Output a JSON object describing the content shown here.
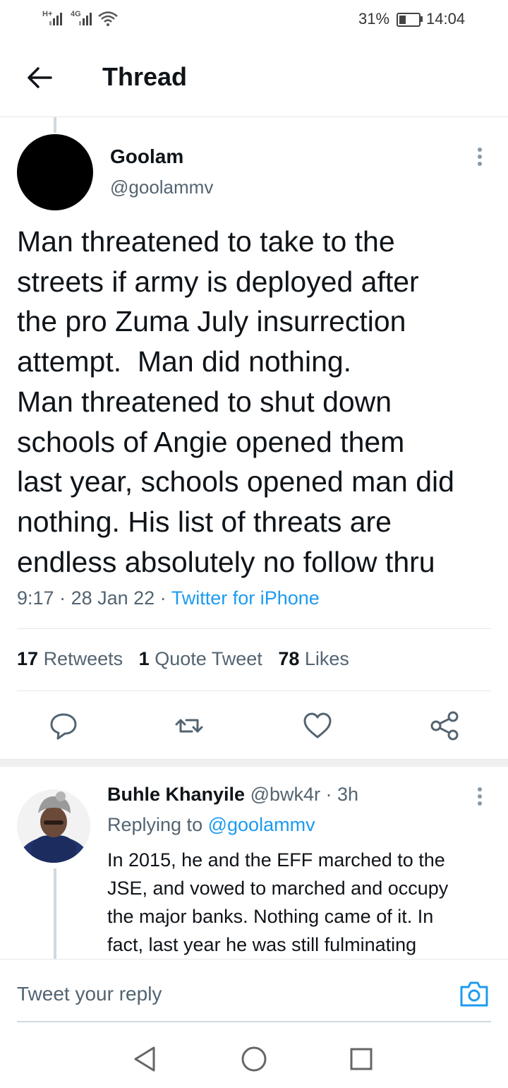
{
  "status_bar": {
    "network1": "H+",
    "network2": "4G",
    "battery_percent": "31%",
    "time": "14:04"
  },
  "header": {
    "title": "Thread",
    "back_icon": "arrow-left-icon"
  },
  "tweet": {
    "name": "Goolam",
    "handle": "@goolammv",
    "text": "Man threatened to take to the\nstreets if army is deployed after\nthe pro Zuma July insurrection\nattempt.  Man did nothing.\nMan threatened to shut down\nschools of Angie opened them\nlast year, schools opened man did\nnothing. His list of threats are\nendless absolutely no follow thru",
    "time": "9:17",
    "date": "28 Jan 22",
    "source": "Twitter for iPhone",
    "retweets_count": "17",
    "retweets_label": "Retweets",
    "quotes_count": "1",
    "quotes_label": "Quote Tweet",
    "likes_count": "78",
    "likes_label": "Likes",
    "actions": [
      "reply-icon",
      "retweet-icon",
      "like-icon",
      "share-icon"
    ]
  },
  "reply": {
    "name": "Buhle Khanyile",
    "handle": "@bwk4r",
    "age": "3h",
    "replying_prefix": "Replying to",
    "replying_to": "@goolammv",
    "text": "In 2015, he and the EFF marched to the\nJSE, and vowed to marched and occupy\nthe major banks. Nothing came of it. In\nfact, last year he was still fulminating"
  },
  "compose": {
    "placeholder": "Tweet your reply",
    "icon": "camera-icon"
  },
  "nav_bar": {
    "icons": [
      "back-triangle-icon",
      "home-circle-icon",
      "recents-square-icon"
    ]
  },
  "colors": {
    "link": "#1d9bf0",
    "muted": "#536471",
    "text": "#0f1419"
  }
}
